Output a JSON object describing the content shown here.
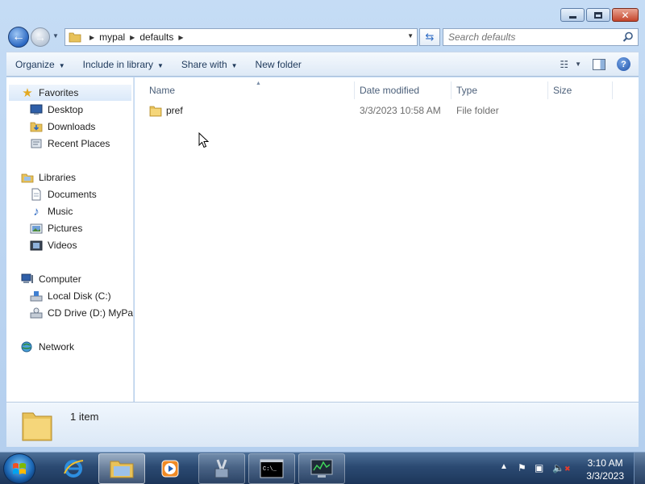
{
  "address_bar": {
    "breadcrumbs": [
      "mypal",
      "defaults"
    ],
    "search_placeholder": "Search defaults"
  },
  "command_bar": {
    "organize": "Organize",
    "include_in_library": "Include in library",
    "share_with": "Share with",
    "new_folder": "New folder"
  },
  "nav_pane": {
    "favorites": {
      "label": "Favorites",
      "items": [
        "Desktop",
        "Downloads",
        "Recent Places"
      ]
    },
    "libraries": {
      "label": "Libraries",
      "items": [
        "Documents",
        "Music",
        "Pictures",
        "Videos"
      ]
    },
    "computer": {
      "label": "Computer",
      "items": [
        "Local Disk (C:)",
        "CD Drive (D:) MyPal"
      ]
    },
    "network": {
      "label": "Network"
    }
  },
  "file_list": {
    "columns": [
      "Name",
      "Date modified",
      "Type",
      "Size"
    ],
    "rows": [
      {
        "name": "pref",
        "date_modified": "3/3/2023 10:58 AM",
        "type": "File folder",
        "size": ""
      }
    ]
  },
  "details_pane": {
    "item_count": "1 item"
  },
  "taskbar": {
    "time": "3:10 AM",
    "date": "3/3/2023",
    "pinned": [
      "internet-explorer",
      "file-explorer",
      "media-player",
      "tools",
      "command-prompt",
      "monitor-app"
    ]
  },
  "colors": {
    "accent": "#2c68c2",
    "taskbar": "#2b4a72",
    "folder": "#e8c25a"
  }
}
